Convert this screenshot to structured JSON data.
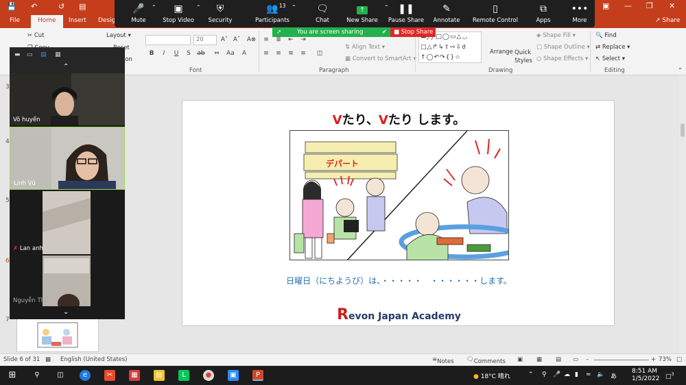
{
  "titlebar": {
    "undo_icon": "undo-icon",
    "redo_icon": "redo-icon"
  },
  "ribbon_tabs": {
    "file": "File",
    "home": "Home",
    "insert": "Insert",
    "design": "Desig",
    "share": "Share"
  },
  "ribbon": {
    "clipboard": {
      "cut": "Cut",
      "copy": "Copy"
    },
    "slides": {
      "layout": "Layout",
      "reset": "Reset",
      "section": "ion"
    },
    "font": {
      "size_placeholder": "20",
      "label": "Font"
    },
    "paragraph": {
      "align_text": "Align Text",
      "convert_smartart": "Convert to SmartArt",
      "label": "Paragraph"
    },
    "drawing": {
      "arrange": "Arrange",
      "quick_styles": "Quick Styles",
      "shape_fill": "Shape Fill",
      "shape_outline": "Shape Outline",
      "shape_effects": "Shape Effects",
      "label": "Drawing"
    },
    "editing": {
      "find": "Find",
      "replace": "Replace",
      "select": "Select",
      "label": "Editing"
    }
  },
  "zoom": {
    "mute": "Mute",
    "stop_video": "Stop Video",
    "security": "Security",
    "participants": "Participants",
    "participant_count": "13",
    "chat": "Chat",
    "new_share": "New Share",
    "pause_share": "Pause Share",
    "annotate": "Annotate",
    "remote_control": "Remote Control",
    "apps": "Apps",
    "more": "More",
    "sharing_notice": "You are screen sharing",
    "stop_share": "Stop Share"
  },
  "participants": [
    {
      "name": "Võ huyền"
    },
    {
      "name": "Linh Vũ"
    },
    {
      "name": "Lan anh"
    },
    {
      "name": "Nguyễn Thị..."
    }
  ],
  "thumbnails": {
    "slide_numbers": [
      "3",
      "4",
      "5",
      "6",
      "7"
    ]
  },
  "slide": {
    "title_v1": "V",
    "title_tari1": "たり、",
    "title_v2": "V",
    "title_tari2": "たり",
    "title_rest": "します。",
    "caption": "日曜日（にちようび）は、・・・・・　・・・・・・します。",
    "brand_r": "R",
    "brand_rest": "evon Japan Academy",
    "illus_sign": "デパート"
  },
  "statusbar": {
    "slide_of": "Slide 6 of 31",
    "language": "English (United States)",
    "notes": "Notes",
    "comments": "Comments",
    "zoom": "73%"
  },
  "taskbar": {
    "weather": "18°C  晴れ",
    "ime": "あ",
    "time": "8:51 AM",
    "date": "1/5/2022",
    "notif_count": "3"
  },
  "colors": {
    "accent": "#c43e1c",
    "zoom_bg": "#1f1f1f",
    "share_green": "#23b14d",
    "stop_red": "#e02828"
  }
}
